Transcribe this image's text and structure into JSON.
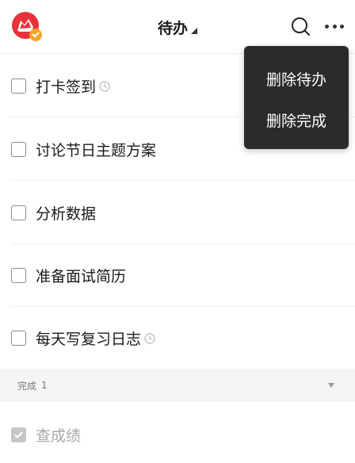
{
  "header": {
    "title": "待办",
    "avatar_icon": "red-shield-logo-icon",
    "search_icon": "search-icon",
    "more_icon": "more-dots-icon"
  },
  "todos": [
    {
      "label": "打卡签到",
      "has_reminder": true
    },
    {
      "label": "讨论节日主题方案",
      "has_reminder": false
    },
    {
      "label": "分析数据",
      "has_reminder": false
    },
    {
      "label": "准备面试简历",
      "has_reminder": false
    },
    {
      "label": "每天写复习日志",
      "has_reminder": true
    }
  ],
  "completed_section": {
    "label": "完成",
    "count": "1"
  },
  "completed_items": [
    {
      "label": "查成绩",
      "checked": true
    }
  ],
  "menu": {
    "items": [
      {
        "label": "删除待办"
      },
      {
        "label": "删除完成"
      }
    ]
  },
  "colors": {
    "brand_red": "#e8313a",
    "badge_orange": "#f5a623",
    "menu_background": "#2b2b2b"
  }
}
